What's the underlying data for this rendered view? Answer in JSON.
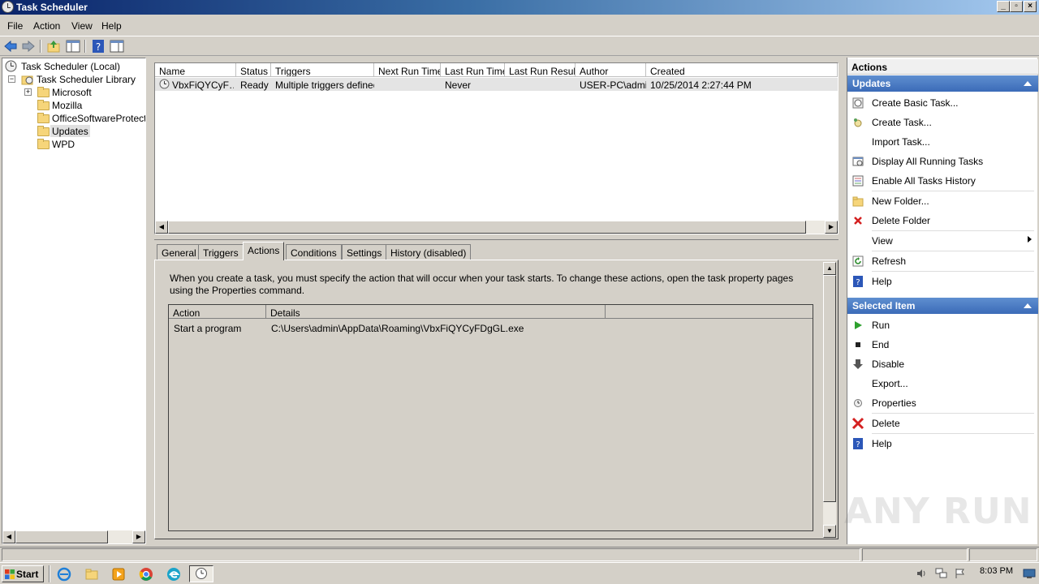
{
  "window": {
    "title": "Task Scheduler"
  },
  "menu": [
    "File",
    "Action",
    "View",
    "Help"
  ],
  "tree": {
    "root": "Task Scheduler (Local)",
    "library": "Task Scheduler Library",
    "folders": [
      "Microsoft",
      "Mozilla",
      "OfficeSoftwareProtectio",
      "Updates",
      "WPD"
    ]
  },
  "tasklist": {
    "columns": [
      "Name",
      "Status",
      "Triggers",
      "Next Run Time",
      "Last Run Time",
      "Last Run Result",
      "Author",
      "Created"
    ],
    "rows": [
      {
        "name": "VbxFiQYCyF…",
        "status": "Ready",
        "triggers": "Multiple triggers defined",
        "next_run": "",
        "last_run": "Never",
        "last_result": "",
        "author": "USER-PC\\admin",
        "created": "10/25/2014 2:27:44 PM"
      }
    ]
  },
  "tabs": [
    "General",
    "Triggers",
    "Actions",
    "Conditions",
    "Settings",
    "History (disabled)"
  ],
  "actions_tab": {
    "description": "When you create a task, you must specify the action that will occur when your task starts.  To change these actions, open the task property pages using the Properties command.",
    "columns": [
      "Action",
      "Details"
    ],
    "rows": [
      {
        "action": "Start a program",
        "details": "C:\\Users\\admin\\AppData\\Roaming\\VbxFiQYCyFDgGL.exe"
      }
    ]
  },
  "actions_pane": {
    "title": "Actions",
    "section1": "Updates",
    "section1_items": [
      "Create Basic Task...",
      "Create Task...",
      "Import Task...",
      "Display All Running Tasks",
      "Enable All Tasks History",
      "New Folder...",
      "Delete Folder",
      "View",
      "Refresh",
      "Help"
    ],
    "section2": "Selected Item",
    "section2_items": [
      "Run",
      "End",
      "Disable",
      "Export...",
      "Properties",
      "Delete",
      "Help"
    ]
  },
  "taskbar": {
    "start": "Start",
    "clock": "8:03 PM"
  },
  "watermark": "ANY RUN"
}
